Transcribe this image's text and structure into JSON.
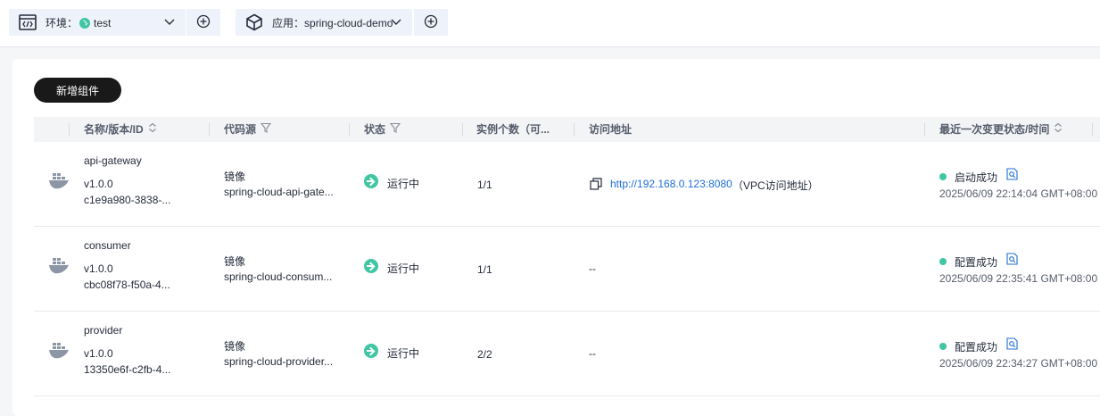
{
  "topbar": {
    "env_label": "环境：",
    "env_value": "test",
    "app_label": "应用：",
    "app_value": "spring-cloud-demo"
  },
  "toolbar": {
    "new_component_label": "新增组件"
  },
  "table": {
    "columns": {
      "name": "名称/版本/ID",
      "source": "代码源",
      "status": "状态",
      "instances": "实例个数（可...",
      "access": "访问地址",
      "last_change": "最近一次变更状态/时间"
    },
    "rows": [
      {
        "name": "api-gateway",
        "version": "v1.0.0",
        "id": "c1e9a980-3838-...",
        "source_type": "镜像",
        "source_name": "spring-cloud-api-gate...",
        "status": "运行中",
        "instances": "1/1",
        "access_url": "http://192.168.0.123:8080",
        "access_note": "（VPC访问地址）",
        "change_status": "启动成功",
        "change_time": "2025/06/09 22:14:04 GMT+08:00"
      },
      {
        "name": "consumer",
        "version": "v1.0.0",
        "id": "cbc08f78-f50a-4...",
        "source_type": "镜像",
        "source_name": "spring-cloud-consum...",
        "status": "运行中",
        "instances": "1/1",
        "access_url": "",
        "access_note": "--",
        "change_status": "配置成功",
        "change_time": "2025/06/09 22:35:41 GMT+08:00"
      },
      {
        "name": "provider",
        "version": "v1.0.0",
        "id": "13350e6f-c2fb-4...",
        "source_type": "镜像",
        "source_name": "spring-cloud-provider...",
        "status": "运行中",
        "instances": "2/2",
        "access_url": "",
        "access_note": "--",
        "change_status": "配置成功",
        "change_time": "2025/06/09 22:34:27 GMT+08:00"
      }
    ]
  },
  "icons": {
    "env": "code-window-icon",
    "app": "cube-icon",
    "add": "plus-circle-icon",
    "dropdown": "chevron-down-icon",
    "sort": "sort-icon",
    "filter": "filter-icon",
    "component": "docker-icon",
    "running": "running-arrow-icon",
    "copy": "copy-icon",
    "detail": "detail-search-icon"
  },
  "colors": {
    "accent_green": "#3fc6a2",
    "link_blue": "#1f6fd6",
    "primary_button": "#191919"
  }
}
